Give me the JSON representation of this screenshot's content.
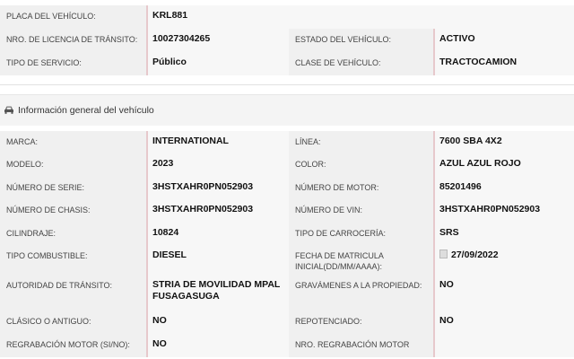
{
  "top": {
    "placa_label": "PLACA DEL VEHÍCULO:",
    "placa_value": "KRL881",
    "licencia_label": "NRO. DE LICENCIA DE TRÁNSITO:",
    "licencia_value": "10027304265",
    "estado_label": "ESTADO DEL VEHÍCULO:",
    "estado_value": "ACTIVO",
    "servicio_label": "TIPO DE SERVICIO:",
    "servicio_value": "Público",
    "clase_label": "CLASE DE VEHÍCULO:",
    "clase_value": "TRACTOCAMION"
  },
  "section": {
    "title": "Información general del vehículo",
    "icon": "car-icon"
  },
  "general": {
    "marca_label": "MARCA:",
    "marca_value": "INTERNATIONAL",
    "linea_label": "LÍNEA:",
    "linea_value": "7600 SBA 4X2",
    "modelo_label": "MODELO:",
    "modelo_value": "2023",
    "color_label": "COLOR:",
    "color_value": "AZUL AZUL ROJO",
    "serie_label": "NÚMERO DE SERIE:",
    "serie_value": "3HSTXAHR0PN052903",
    "motor_label": "NÚMERO DE MOTOR:",
    "motor_value": "85201496",
    "chasis_label": "NÚMERO DE CHASIS:",
    "chasis_value": "3HSTXAHR0PN052903",
    "vin_label": "NÚMERO DE VIN:",
    "vin_value": "3HSTXAHR0PN052903",
    "cilindraje_label": "CILINDRAJE:",
    "cilindraje_value": "10824",
    "carroceria_label": "TIPO DE CARROCERÍA:",
    "carroceria_value": "SRS",
    "combustible_label": "TIPO COMBUSTIBLE:",
    "combustible_value": "DIESEL",
    "matricula_label_line1": "FECHA DE MATRICULA",
    "matricula_label_line2": "INICIAL(DD/MM/AAAA):",
    "matricula_value": "27/09/2022",
    "autoridad_label": "AUTORIDAD DE TRÁNSITO:",
    "autoridad_value_line1": "STRIA DE MOVILIDAD MPAL",
    "autoridad_value_line2": "FUSAGASUGA",
    "gravamenes_label": "GRAVÁMENES A LA PROPIEDAD:",
    "gravamenes_value": "NO",
    "clasico_label": "CLÁSICO O ANTIGUO:",
    "clasico_value": "NO",
    "repotenciado_label": "REPOTENCIADO:",
    "repotenciado_value": "NO",
    "regrabacion_label": "REGRABACIÓN MOTOR (SI/NO):",
    "regrabacion_value": "NO",
    "nro_regrabacion_label": "NRO. REGRABACIÓN MOTOR",
    "nro_regrabacion_value": ""
  }
}
